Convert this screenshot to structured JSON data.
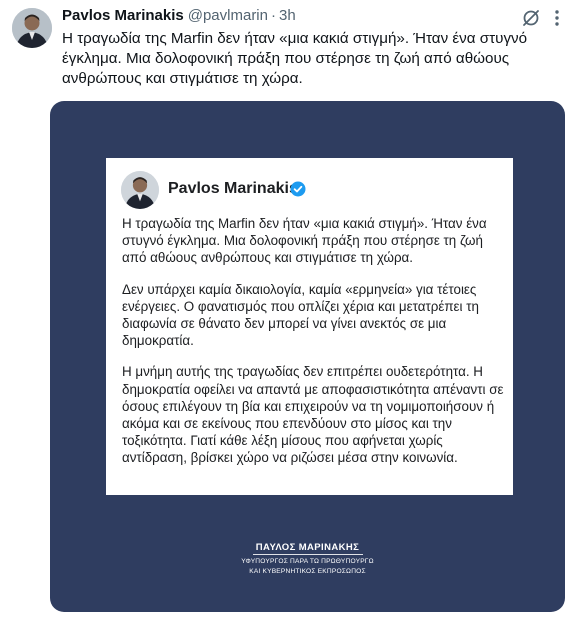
{
  "tweet": {
    "author_name": "Pavlos Marinakis",
    "handle": "@pavlmarin",
    "separator": "·",
    "time": "3h",
    "text": "Η τραγωδία της Marfin δεν ήταν «μια κακιά στιγμή». Ήταν ένα στυγνό έγκλημα. Μια δολοφονική πράξη που στέρησε τη ζωή από αθώους ανθρώπους και στιγμάτισε τη χώρα."
  },
  "icons": {
    "avatar": "profile-photo",
    "grok": "grok-slash-icon",
    "more": "more-vertical-icon",
    "verified": "verified-badge-icon"
  },
  "media": {
    "background_color": "#2f3d60",
    "card": {
      "name": "Pavlos Marinakis",
      "verified_color": "#1d9bf0",
      "paragraphs": [
        "Η τραγωδία της Marfin δεν ήταν «μια κακιά στιγμή». Ήταν ένα στυγνό έγκλημα. Μια δολοφονική πράξη που στέρησε τη ζωή από αθώους ανθρώπους και στιγμάτισε τη χώρα.",
        "Δεν υπάρχει καμία δικαιολογία, καμία «ερμηνεία» για τέτοιες ενέργειες. Ο φανατισμός που οπλίζει χέρια και μετατρέπει τη διαφωνία σε θάνατο δεν μπορεί να γίνει ανεκτός σε μια δημοκρατία.",
        "Η μνήμη αυτής της τραγωδίας δεν επιτρέπει ουδετερότητα. Η δημοκρατία οφείλει να απαντά με αποφασιστικότητα απέναντι σε όσους επιλέγουν τη βία και επιχειρούν να τη νομιμοποιήσουν ή ακόμα και σε εκείνους που επενδύουν στο μίσος και την τοξικότητα. Γιατί κάθε λέξη μίσους που αφήνεται χωρίς αντίδραση, βρίσκει χώρο να ριζώσει μέσα στην κοινωνία."
      ]
    },
    "signature": {
      "name": "ΠΑΥΛΟΣ ΜΑΡΙΝΑΚΗΣ",
      "title_line1": "ΥΦΥΠΟΥΡΓΟΣ ΠΑΡΑ ΤΩ ΠΡΩΘΥΠΟΥΡΓΩ",
      "title_line2": "ΚΑΙ ΚΥΒΕΡΝΗΤΙΚΟΣ ΕΚΠΡΟΣΩΠΟΣ"
    }
  }
}
